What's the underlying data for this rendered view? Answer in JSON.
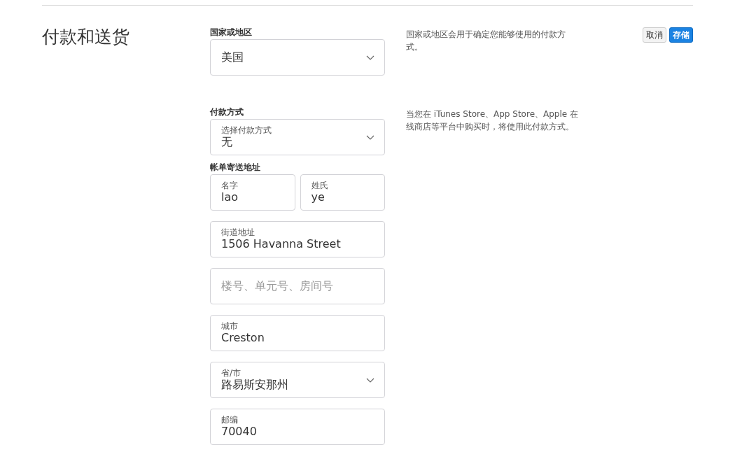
{
  "heading": "付款和送货",
  "buttons": [
    {
      "label": "取消",
      "kind": "secondary"
    },
    {
      "label": "存储",
      "kind": "primary"
    }
  ],
  "sections": [
    {
      "label": "国家或地区",
      "help": "国家或地区会用于确定您能够使用的付款方式。",
      "rows": [
        [
          {
            "kind": "select",
            "value": "美国"
          }
        ]
      ]
    },
    {
      "label": "付款方式",
      "help": "当您在 iTunes Store、App Store、Apple 在线商店等平台中购买时，将使用此付款方式。",
      "rows": [
        [
          {
            "kind": "select",
            "label": "选择付款方式",
            "value": "无"
          }
        ]
      ]
    },
    {
      "label": "帐单寄送地址",
      "rows": [
        [
          {
            "kind": "text",
            "label": "名字",
            "value": "lao"
          },
          {
            "kind": "text",
            "label": "姓氏",
            "value": "ye"
          }
        ],
        [
          {
            "kind": "text",
            "label": "街道地址",
            "value": "1506 Havanna Street"
          }
        ],
        [
          {
            "kind": "text",
            "placeholder": "楼号、单元号、房间号"
          }
        ],
        [
          {
            "kind": "text",
            "label": "城市",
            "value": "Creston"
          }
        ],
        [
          {
            "kind": "select",
            "label": "省/市",
            "value": "路易斯安那州"
          }
        ],
        [
          {
            "kind": "text",
            "label": "邮编",
            "value": "70040"
          }
        ]
      ]
    }
  ]
}
